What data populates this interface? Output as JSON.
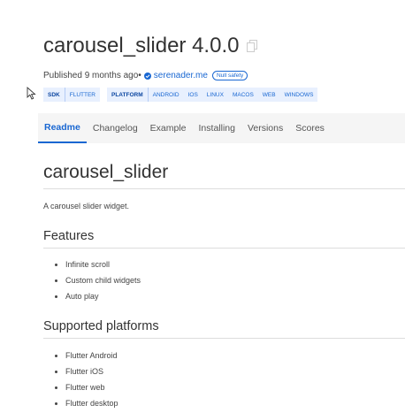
{
  "package": {
    "title": "carousel_slider 4.0.0",
    "published_prefix": "Published 9 months ago•",
    "publisher": "serenader.me",
    "null_safety_badge": "Null safety"
  },
  "tags": {
    "sdk_label": "SDK",
    "sdk_items": [
      "FLUTTER"
    ],
    "platform_label": "PLATFORM",
    "platform_items": [
      "ANDROID",
      "IOS",
      "LINUX",
      "MACOS",
      "WEB",
      "WINDOWS"
    ]
  },
  "tabs": [
    {
      "label": "Readme",
      "active": true
    },
    {
      "label": "Changelog"
    },
    {
      "label": "Example"
    },
    {
      "label": "Installing"
    },
    {
      "label": "Versions"
    },
    {
      "label": "Scores"
    }
  ],
  "readme": {
    "heading": "carousel_slider",
    "description": "A carousel slider widget.",
    "features_heading": "Features",
    "features": [
      "Infinite scroll",
      "Custom child widgets",
      "Auto play"
    ],
    "platforms_heading": "Supported platforms",
    "platforms": [
      "Flutter Android",
      "Flutter iOS",
      "Flutter web",
      "Flutter desktop"
    ]
  },
  "colors": {
    "accent": "#1967d2",
    "tag_background": "#e8f0fe",
    "tabs_background": "#f5f5f5",
    "text": "#333333"
  },
  "icons": {
    "copy": "copy-icon",
    "verified": "verified-publisher-icon",
    "cursor": "mouse-pointer-icon"
  }
}
